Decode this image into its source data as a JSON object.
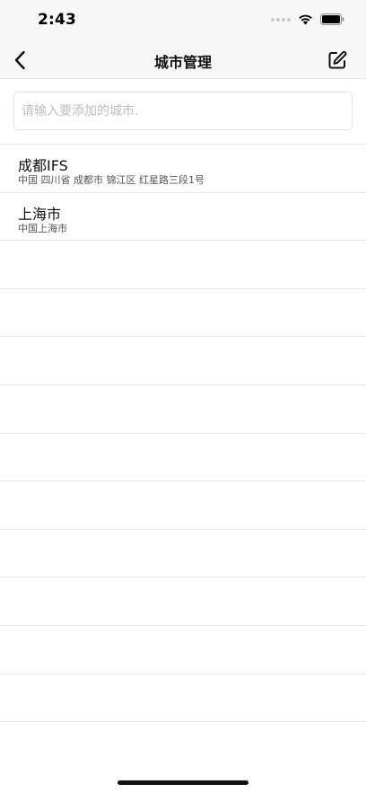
{
  "status_bar": {
    "time": "2:43"
  },
  "nav": {
    "title": "城市管理",
    "back_icon": "chevron-left-icon",
    "edit_icon": "edit-icon"
  },
  "search": {
    "value": "",
    "placeholder": "请输入要添加的城市."
  },
  "cities": [
    {
      "name": "成都IFS",
      "address": "中国 四川省 成都市 锦江区 红星路三段1号"
    },
    {
      "name": "上海市",
      "address": "中国上海市"
    }
  ]
}
